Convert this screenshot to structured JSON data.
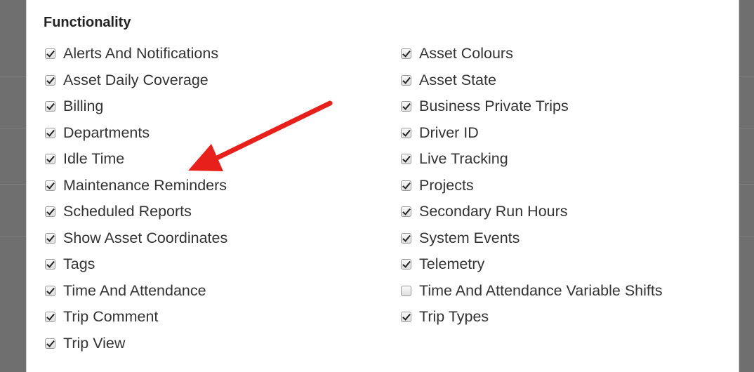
{
  "section": {
    "title": "Functionality"
  },
  "left_items": [
    {
      "label": "Alerts And Notifications",
      "checked": true
    },
    {
      "label": "Asset Daily Coverage",
      "checked": true
    },
    {
      "label": "Billing",
      "checked": true
    },
    {
      "label": "Departments",
      "checked": true
    },
    {
      "label": "Idle Time",
      "checked": true
    },
    {
      "label": "Maintenance Reminders",
      "checked": true
    },
    {
      "label": "Scheduled Reports",
      "checked": true
    },
    {
      "label": "Show Asset Coordinates",
      "checked": true
    },
    {
      "label": "Tags",
      "checked": true
    },
    {
      "label": "Time And Attendance",
      "checked": true
    },
    {
      "label": "Trip Comment",
      "checked": true
    },
    {
      "label": "Trip View",
      "checked": true
    }
  ],
  "right_items": [
    {
      "label": "Asset Colours",
      "checked": true
    },
    {
      "label": "Asset State",
      "checked": true
    },
    {
      "label": "Business Private Trips",
      "checked": true
    },
    {
      "label": "Driver ID",
      "checked": true
    },
    {
      "label": "Live Tracking",
      "checked": true
    },
    {
      "label": "Projects",
      "checked": true
    },
    {
      "label": "Secondary Run Hours",
      "checked": true
    },
    {
      "label": "System Events",
      "checked": true
    },
    {
      "label": "Telemetry",
      "checked": true
    },
    {
      "label": "Time And Attendance Variable Shifts",
      "checked": false
    },
    {
      "label": "Trip Types",
      "checked": true
    }
  ],
  "colors": {
    "arrow": "#e8201c",
    "backdrop": "#6f6f6f"
  },
  "annotation": {
    "icon": "red-arrow-icon",
    "points_to": "Maintenance Reminders"
  }
}
